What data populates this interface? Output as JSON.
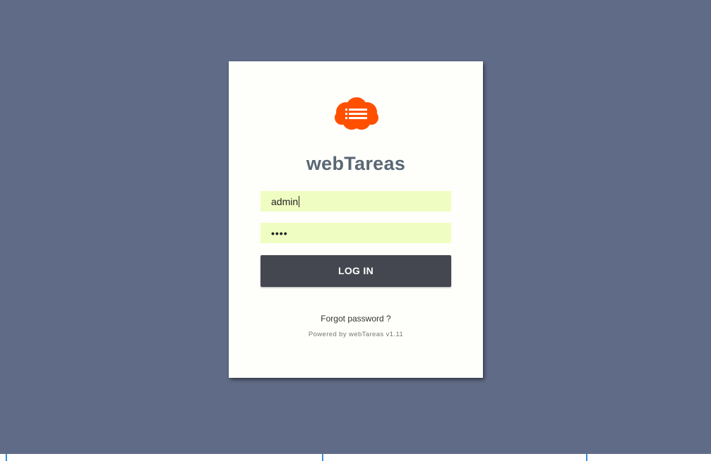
{
  "app": {
    "title": "webTareas",
    "powered_by": "Powered by webTareas v1.11"
  },
  "login": {
    "username_value": "admin",
    "password_mask": "••••",
    "button_label": "LOG IN",
    "forgot_label": "Forgot password ?"
  },
  "colors": {
    "background": "#606c87",
    "card": "#fefefa",
    "logo": "#ff5000",
    "input_bg": "#f0fdc2",
    "button_bg": "#44474f",
    "title_text": "#596775"
  },
  "icons": {
    "logo": "cloud-list-icon"
  }
}
